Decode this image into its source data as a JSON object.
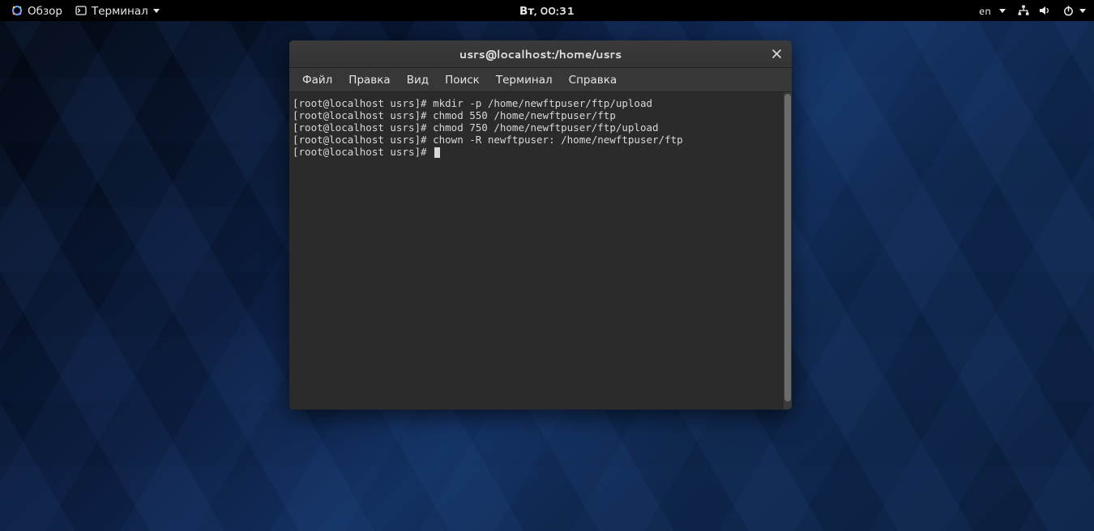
{
  "topbar": {
    "activities": "Обзор",
    "app_name": "Терминал",
    "clock": "Вт, 00:31",
    "lang": "en"
  },
  "window": {
    "title": "usrs@localhost:/home/usrs",
    "menu": {
      "file": "Файл",
      "edit": "Правка",
      "view": "Вид",
      "search": "Поиск",
      "terminal": "Терминал",
      "help": "Справка"
    },
    "lines": [
      "[root@localhost usrs]# mkdir -p /home/newftpuser/ftp/upload",
      "[root@localhost usrs]# chmod 550 /home/newftpuser/ftp",
      "[root@localhost usrs]# chmod 750 /home/newftpuser/ftp/upload",
      "[root@localhost usrs]# chown -R newftpuser: /home/newftpuser/ftp"
    ],
    "prompt": "[root@localhost usrs]# "
  }
}
